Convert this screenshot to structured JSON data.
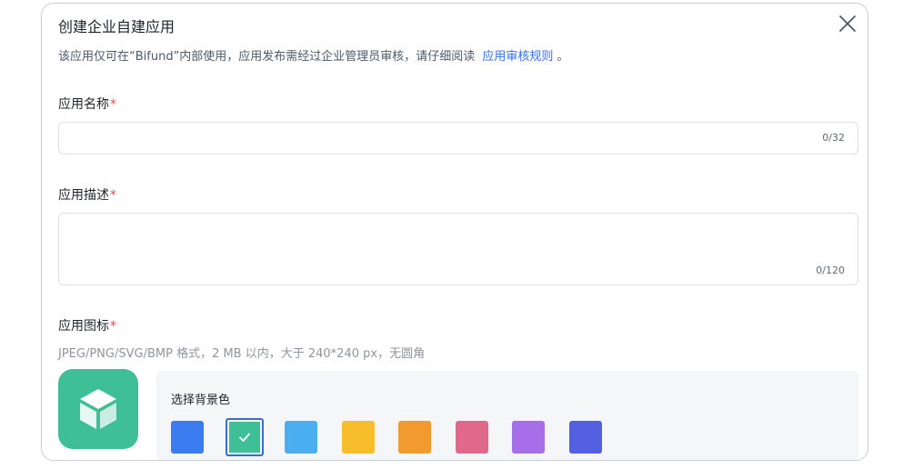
{
  "dialog": {
    "title": "创建企业自建应用",
    "subtitle": "该应用仅可在“Bifund”内部使用，应用发布需经过企业管理员审核，请仔细阅读",
    "rules_link": "应用审核规则",
    "rules_suffix": "。"
  },
  "name_field": {
    "label": "应用名称",
    "required_mark": "*",
    "value": "",
    "counter": "0/32"
  },
  "desc_field": {
    "label": "应用描述",
    "required_mark": "*",
    "value": "",
    "counter": "0/120"
  },
  "icon_field": {
    "label": "应用图标",
    "required_mark": "*",
    "hint": "JPEG/PNG/SVG/BMP 格式，2 MB 以内，大于 240*240 px，无圆角",
    "icon_name": "cube-icon",
    "icon_bg": "#3fbf95"
  },
  "background_picker": {
    "title": "选择背景色",
    "selected_index": 1,
    "colors": [
      "#3b7cf0",
      "#3fbf95",
      "#4aaef0",
      "#f7bd2a",
      "#f29a2e",
      "#e0688a",
      "#a66ee8",
      "#5560e0"
    ]
  }
}
